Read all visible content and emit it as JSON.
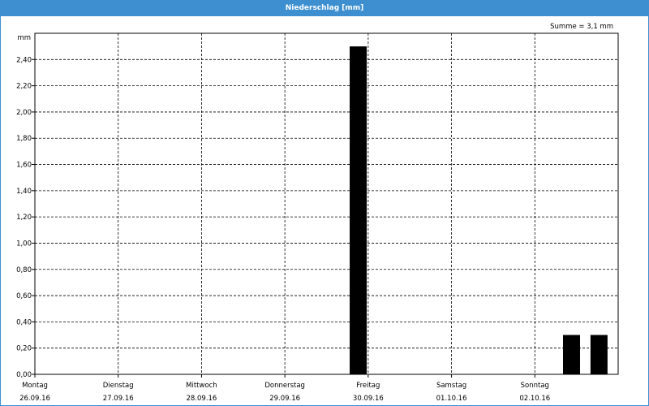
{
  "window": {
    "title": "Niederschlag [mm]"
  },
  "summary": "Summe = 3,1 mm",
  "colors": {
    "titlebar": "#3d8fd0",
    "bar": "#000000",
    "grid": "#000000"
  },
  "chart_data": {
    "type": "bar",
    "ylabel": "mm",
    "ylim": [
      0,
      2.6
    ],
    "yticks": [
      "0,00",
      "0,20",
      "0,40",
      "0,60",
      "0,80",
      "1,00",
      "1,20",
      "1,40",
      "1,60",
      "1,80",
      "2,00",
      "2,20",
      "2,40"
    ],
    "grid": true,
    "x_range_days": [
      0,
      7
    ],
    "days": [
      {
        "weekday": "Montag",
        "date": "26.09.16"
      },
      {
        "weekday": "Dienstag",
        "date": "27.09.16"
      },
      {
        "weekday": "Mittwoch",
        "date": "28.09.16"
      },
      {
        "weekday": "Donnerstag",
        "date": "29.09.16"
      },
      {
        "weekday": "Freitag",
        "date": "30.09.16"
      },
      {
        "weekday": "Samstag",
        "date": "01.10.16"
      },
      {
        "weekday": "Sonntag",
        "date": "02.10.16"
      }
    ],
    "bars": [
      {
        "day": 3.88,
        "value": 2.5
      },
      {
        "day": 6.44,
        "value": 0.3
      },
      {
        "day": 6.77,
        "value": 0.3
      }
    ]
  }
}
